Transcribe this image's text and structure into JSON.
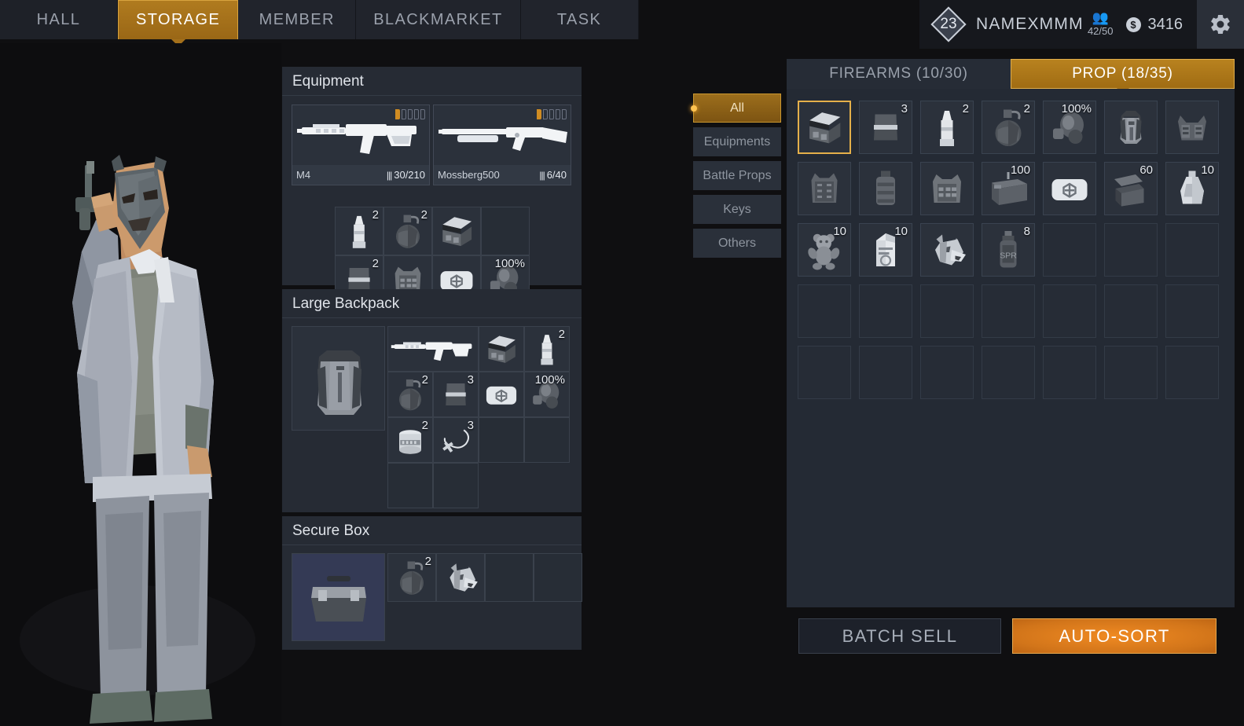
{
  "nav": {
    "tabs": [
      {
        "label": "HALL",
        "active": false
      },
      {
        "label": "STORAGE",
        "active": true
      },
      {
        "label": "MEMBER",
        "active": false
      },
      {
        "label": "BLACKMARKET",
        "active": false
      },
      {
        "label": "TASK",
        "active": false
      }
    ]
  },
  "user": {
    "level": "23",
    "name": "NAMEXMMM",
    "capacity": "42/50",
    "currency_symbol": "$",
    "currency": "3416",
    "settings_icon": "gear-icon",
    "people_icon": "people-icon"
  },
  "colors": {
    "accent": "#b07b1f",
    "accent_bright": "#e5b04a",
    "panel": "#262b34",
    "slot": "#2b313b",
    "background": "#0f0f11",
    "orange_button": "#f08a22"
  },
  "equipment": {
    "title": "Equipment",
    "weapons": [
      {
        "name": "M4",
        "ammo": "30/210",
        "icon": "assault-rifle-icon",
        "attachments_total": 5,
        "attachments_filled": 1
      },
      {
        "name": "Mossberg500",
        "ammo": "6/40",
        "icon": "shotgun-icon",
        "attachments_total": 5,
        "attachments_filled": 1
      }
    ],
    "slots": [
      {
        "icon": "ammo-round-icon",
        "qty": "2"
      },
      {
        "icon": "grenade-icon",
        "qty": "2"
      },
      {
        "icon": "ammo-box-icon",
        "qty": ""
      },
      {
        "icon": "",
        "qty": ""
      },
      {
        "icon": "magazine-icon",
        "qty": "2"
      },
      {
        "icon": "body-armor-icon",
        "qty": ""
      },
      {
        "icon": "medkit-icon",
        "qty": ""
      },
      {
        "icon": "gas-mask-icon",
        "qty": "100%"
      }
    ]
  },
  "backpack": {
    "title": "Large Backpack",
    "container_icon": "backpack-icon",
    "slots": [
      {
        "icon": "assault-rifle-icon",
        "qty": "",
        "wide": true
      },
      {
        "icon": "ammo-box-icon",
        "qty": ""
      },
      {
        "icon": "ammo-round-icon",
        "qty": "2"
      },
      {
        "icon": "grenade-icon",
        "qty": "2"
      },
      {
        "icon": "magazine-icon",
        "qty": "3"
      },
      {
        "icon": "medkit-icon",
        "qty": ""
      },
      {
        "icon": "gas-mask-icon",
        "qty": "100%"
      },
      {
        "icon": "can-icon",
        "qty": "2"
      },
      {
        "icon": "necklace-icon",
        "qty": "3"
      },
      {
        "icon": "",
        "qty": ""
      },
      {
        "icon": "",
        "qty": ""
      },
      {
        "icon": "",
        "qty": ""
      },
      {
        "icon": "",
        "qty": ""
      }
    ]
  },
  "secure_box": {
    "title": "Secure Box",
    "container_icon": "toolbox-icon",
    "slots": [
      {
        "icon": "grenade-icon",
        "qty": "2"
      },
      {
        "icon": "wolf-head-icon",
        "qty": ""
      },
      {
        "icon": "",
        "qty": ""
      },
      {
        "icon": "",
        "qty": ""
      }
    ]
  },
  "storage": {
    "tabs": [
      {
        "label": "FIREARMS (10/30)",
        "active": false
      },
      {
        "label": "PROP (18/35)",
        "active": true
      }
    ],
    "filters": [
      {
        "label": "All",
        "active": true
      },
      {
        "label": "Equipments",
        "active": false
      },
      {
        "label": "Battle Props",
        "active": false
      },
      {
        "label": "Keys",
        "active": false
      },
      {
        "label": "Others",
        "active": false
      }
    ],
    "items": [
      {
        "icon": "ammo-box-icon",
        "qty": "",
        "selected": true
      },
      {
        "icon": "magazine-icon",
        "qty": "3",
        "selected": false
      },
      {
        "icon": "ammo-round-icon",
        "qty": "2",
        "selected": false
      },
      {
        "icon": "grenade-icon",
        "qty": "2",
        "selected": false
      },
      {
        "icon": "gas-mask-icon",
        "qty": "100%",
        "selected": false
      },
      {
        "icon": "backpack-icon",
        "qty": "",
        "selected": false
      },
      {
        "icon": "chest-rig-icon",
        "qty": "",
        "selected": false
      },
      {
        "icon": "tactical-vest-icon",
        "qty": "",
        "selected": false
      },
      {
        "icon": "canteen-icon",
        "qty": "",
        "selected": false
      },
      {
        "icon": "body-armor-icon",
        "qty": "",
        "selected": false
      },
      {
        "icon": "supply-crate-icon",
        "qty": "100",
        "selected": false
      },
      {
        "icon": "medkit-icon",
        "qty": "",
        "selected": false
      },
      {
        "icon": "open-crate-icon",
        "qty": "60",
        "selected": false
      },
      {
        "icon": "flask-icon",
        "qty": "10",
        "selected": false
      },
      {
        "icon": "teddy-bear-icon",
        "qty": "10",
        "selected": false
      },
      {
        "icon": "milk-carton-icon",
        "qty": "10",
        "selected": false
      },
      {
        "icon": "wolf-head-icon",
        "qty": "",
        "selected": false
      },
      {
        "icon": "spray-can-icon",
        "qty": "8",
        "selected": false
      },
      {
        "icon": "",
        "qty": "",
        "selected": false
      },
      {
        "icon": "",
        "qty": "",
        "selected": false
      },
      {
        "icon": "",
        "qty": "",
        "selected": false
      },
      {
        "icon": "",
        "qty": "",
        "selected": false
      },
      {
        "icon": "",
        "qty": "",
        "selected": false
      },
      {
        "icon": "",
        "qty": "",
        "selected": false
      },
      {
        "icon": "",
        "qty": "",
        "selected": false
      },
      {
        "icon": "",
        "qty": "",
        "selected": false
      },
      {
        "icon": "",
        "qty": "",
        "selected": false
      },
      {
        "icon": "",
        "qty": "",
        "selected": false
      },
      {
        "icon": "",
        "qty": "",
        "selected": false
      },
      {
        "icon": "",
        "qty": "",
        "selected": false
      },
      {
        "icon": "",
        "qty": "",
        "selected": false
      },
      {
        "icon": "",
        "qty": "",
        "selected": false
      },
      {
        "icon": "",
        "qty": "",
        "selected": false
      },
      {
        "icon": "",
        "qty": "",
        "selected": false
      },
      {
        "icon": "",
        "qty": "",
        "selected": false
      }
    ],
    "buttons": {
      "batch_sell": "BATCH SELL",
      "auto_sort": "AUTO-SORT"
    }
  },
  "character": {
    "pose": "low-poly-character-with-pistol"
  }
}
